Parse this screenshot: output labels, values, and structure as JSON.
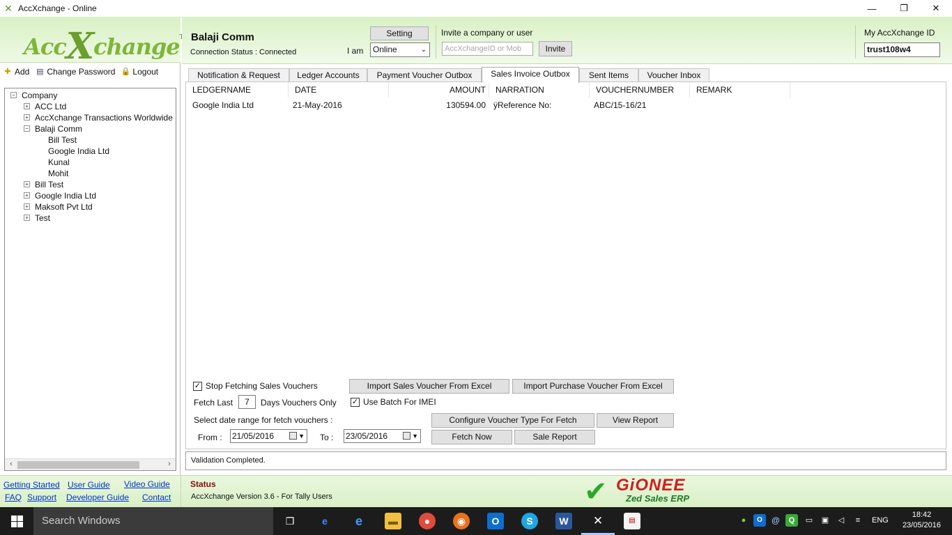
{
  "window": {
    "title": "AccXchange - Online",
    "minimize": "—",
    "restore": "❐",
    "close": "✕"
  },
  "logo": {
    "text_left": "Acc",
    "text_x": "X",
    "text_right": "change",
    "tm": "TM"
  },
  "left_toolbar": {
    "add": "Add",
    "change_password": "Change Password",
    "logout": "Logout"
  },
  "tree": {
    "root": "Company",
    "items": [
      {
        "label": "ACC Ltd",
        "expander": "+"
      },
      {
        "label": "AccXchange Transactions Worldwide",
        "expander": "+"
      },
      {
        "label": "Balaji Comm",
        "expander": "−",
        "children": [
          "Bill Test",
          "Google India Ltd",
          "Kunal",
          "Mohit"
        ]
      },
      {
        "label": "Bill Test",
        "expander": "+"
      },
      {
        "label": "Google India Ltd",
        "expander": "+"
      },
      {
        "label": "Maksoft Pvt Ltd",
        "expander": "+"
      },
      {
        "label": "Test",
        "expander": "+"
      }
    ],
    "root_expander": "−"
  },
  "header": {
    "company_name": "Balaji Comm",
    "connection_status": "Connection Status : Connected",
    "setting_label": "Setting",
    "iam_label": "I am",
    "iam_value": "Online",
    "invite_label": "Invite a company or user",
    "invite_placeholder": "AccXchangeID or Mob",
    "invite_button": "Invite",
    "my_id_label": "My AccXchange ID",
    "my_id_value": "trust108w4"
  },
  "tabs": [
    {
      "label": "Notification & Request"
    },
    {
      "label": "Ledger Accounts"
    },
    {
      "label": "Payment Voucher Outbox"
    },
    {
      "label": "Sales Invoice Outbox",
      "active": true
    },
    {
      "label": "Sent Items"
    },
    {
      "label": "Voucher Inbox"
    }
  ],
  "grid": {
    "columns": [
      "LEDGERNAME",
      "DATE",
      "AMOUNT",
      "NARRATION",
      "VOUCHERNUMBER",
      "REMARK"
    ],
    "rows": [
      [
        "Google India Ltd",
        "21-May-2016",
        "130594.00",
        "ÿReference No:",
        "ABC/15-16/21",
        ""
      ]
    ]
  },
  "options": {
    "stop_fetching": "Stop Fetching Sales Vouchers",
    "stop_fetching_checked": true,
    "import_sales": "Import Sales Voucher From Excel",
    "import_purchase": "Import Purchase Voucher From Excel",
    "fetch_last": "Fetch Last",
    "fetch_days": "7",
    "days_only": "Days Vouchers Only",
    "use_batch": "Use Batch For IMEI",
    "use_batch_checked": true,
    "select_range": "Select date range for fetch vouchers :",
    "configure": "Configure Voucher Type For Fetch",
    "view_report": "View Report",
    "from_label": "From :",
    "from_date": "21/05/2016",
    "to_label": "To :",
    "to_date": "23/05/2016",
    "fetch_now": "Fetch Now",
    "sale_report": "Sale Report",
    "check_glyph": "✓"
  },
  "status_line": "Validation Completed.",
  "footer": {
    "links": {
      "getting_started": "Getting Started",
      "user_guide": "User Guide",
      "video_guide": "Video Guide",
      "faq": "FAQ",
      "support": "Support",
      "developer_guide": "Developer Guide",
      "contact": "Contact"
    },
    "status_title": "Status",
    "version": "AccXchange Version 3.6 - For Tally Users",
    "brand": "GiONEE",
    "brand_sub": "Zed Sales ERP",
    "check": "✔"
  },
  "taskbar": {
    "search_placeholder": "Search Windows",
    "lang": "ENG",
    "time": "18:42",
    "date": "23/05/2016"
  },
  "colors": {
    "accent_green": "#7eb637",
    "status_red": "#8a0a0a",
    "link_blue": "#0033cc",
    "brand_red": "#d21d1d"
  }
}
